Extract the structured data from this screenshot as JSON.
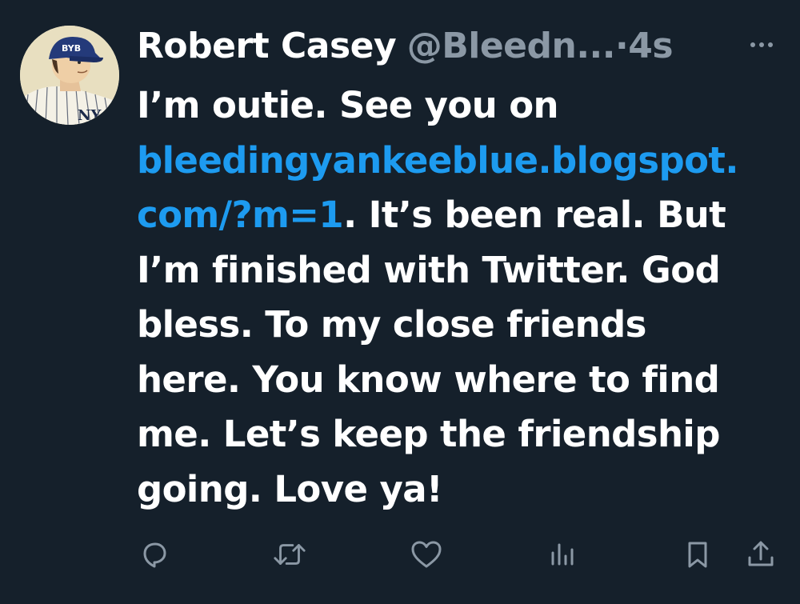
{
  "author": {
    "display_name": "Robert Casey",
    "handle": "@Bleedn...",
    "separator": "·",
    "time": "4s",
    "avatar_badge": "BYB"
  },
  "tweet": {
    "lines": [
      {
        "text": "I’m outie. See you on"
      },
      {
        "link": "bleedingyankeeblue.blogspot."
      },
      {
        "link": "com/?m=1",
        "text": ". It’s been real. But"
      },
      {
        "text": "I’m finished with Twitter. God"
      },
      {
        "text": "bless. To my close friends"
      },
      {
        "text": "here. You know where to find"
      },
      {
        "text": "me. Let’s keep the friendship"
      },
      {
        "text": "going. Love ya!"
      }
    ]
  },
  "actions": [
    "reply-icon",
    "retweet-icon",
    "like-icon",
    "views-icon",
    "bookmark-icon",
    "share-icon"
  ],
  "colors": {
    "background": "#15202b",
    "text": "#ffffff",
    "muted": "#8b98a5",
    "link": "#1d9bf0"
  }
}
